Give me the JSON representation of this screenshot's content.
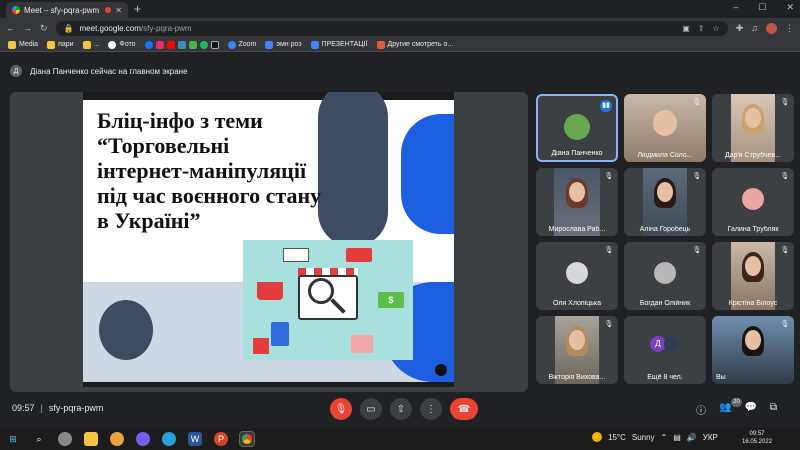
{
  "browser": {
    "tab_title": "Meet – sfy-pqra-pwm",
    "new_tab": "+",
    "window_controls": [
      "–",
      "☐",
      "✕"
    ],
    "url_host": "meet.google.com",
    "url_path": "/sfy-pqra-pwm"
  },
  "bookmarks": [
    {
      "label": "Media",
      "color": "#f4c542"
    },
    {
      "label": "пари",
      "color": "#f4c542"
    },
    {
      "label": "...",
      "color": "#f4c542"
    },
    {
      "label": "Фото",
      "color": "#ffffff"
    },
    {
      "label": "Zoom",
      "color": "#2d8cff"
    },
    {
      "label": "эмн роз",
      "color": "#4285f4"
    },
    {
      "label": "ПРЕЗЕНТАЦІЇ",
      "color": "#4285f4"
    },
    {
      "label": "Другие смотреть о...",
      "color": "#e8593b"
    }
  ],
  "banner": {
    "avatar_letter": "Д",
    "text": "Діана Панченко сейчас на главном экране"
  },
  "slide": {
    "title_lines": [
      "Бліц-інфо з теми",
      "“Торговельні",
      "інтернет-маніпуляції",
      "під час воєнного стану",
      "в Україні”"
    ],
    "money_symbol": "$"
  },
  "participants": [
    {
      "name": "Діана Панченко",
      "state": "speaking"
    },
    {
      "name": "Людмила Соло...",
      "state": "muted"
    },
    {
      "name": "Дар'я Струбчев...",
      "state": "muted"
    },
    {
      "name": "Мирослава Раб...",
      "state": "muted"
    },
    {
      "name": "Аліна Горобець",
      "state": "muted"
    },
    {
      "name": "Галина Трубляк",
      "state": "muted"
    },
    {
      "name": "Оля Хлопіцька",
      "state": "muted"
    },
    {
      "name": "Богдан Олійник",
      "state": "muted"
    },
    {
      "name": "Крістіна Білоус",
      "state": "muted"
    },
    {
      "name": "Вікторія Вихова...",
      "state": "muted"
    },
    {
      "name": "Ещё 8 чел.",
      "state": "more",
      "avatar_letter": "Д"
    },
    {
      "name": "Вы",
      "state": "muted"
    }
  ],
  "meeting": {
    "time": "09:57",
    "separator": "|",
    "code": "sfy-pqra-pwm",
    "people_count": "20"
  },
  "taskbar": {
    "temperature": "15°C",
    "weather": "Sunny",
    "language": "УКР",
    "clock_time": "09:57",
    "clock_date": "16.05.2022"
  },
  "colors": {
    "accent_blue": "#1e5ee0",
    "end_call_red": "#ea4335",
    "speaking_border": "#8ab4f8"
  }
}
